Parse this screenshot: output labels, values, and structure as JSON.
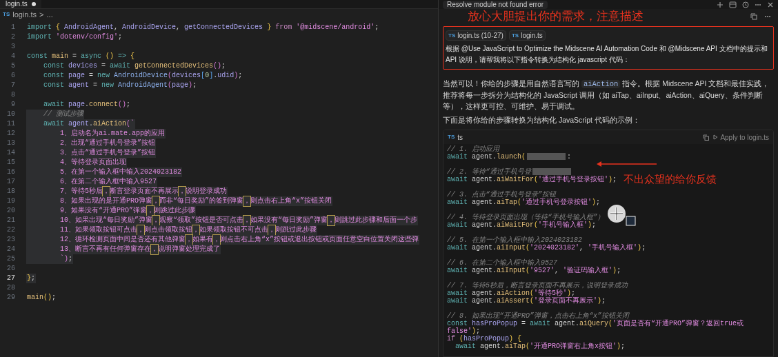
{
  "editor": {
    "tab": {
      "title": "login.ts",
      "modified": true
    },
    "breadcrumb": {
      "file_badge": "TS",
      "file": "login.ts",
      "separator": ">",
      "rest": "..."
    },
    "lines": [
      {
        "n": "1",
        "selected": false,
        "active": false,
        "tokens": [
          {
            "kind": "kw",
            "text": "import "
          },
          {
            "kind": "brace",
            "text": "{ "
          },
          {
            "kind": "id",
            "text": "AndroidAgent"
          },
          {
            "kind": "plain",
            "text": ", "
          },
          {
            "kind": "id",
            "text": "AndroidDevice"
          },
          {
            "kind": "plain",
            "text": ", "
          },
          {
            "kind": "id",
            "text": "getConnectedDevices "
          },
          {
            "kind": "brace",
            "text": "} "
          },
          {
            "kind": "kw2",
            "text": "from "
          },
          {
            "kind": "str",
            "text": "'@midscene/android'"
          },
          {
            "kind": "plain",
            "text": ";"
          }
        ]
      },
      {
        "n": "2",
        "selected": false,
        "active": false,
        "tokens": [
          {
            "kind": "kw",
            "text": "import "
          },
          {
            "kind": "str",
            "text": "'dotenv/config'"
          },
          {
            "kind": "plain",
            "text": ";"
          }
        ]
      },
      {
        "n": "3",
        "selected": false,
        "active": false
      },
      {
        "n": "4",
        "selected": false,
        "active": false,
        "tokens": [
          {
            "kind": "kw",
            "text": "const "
          },
          {
            "kind": "fn",
            "text": "main "
          },
          {
            "kind": "plain",
            "text": "= "
          },
          {
            "kind": "kw",
            "text": "async "
          },
          {
            "kind": "brace",
            "text": "() "
          },
          {
            "kind": "kw",
            "text": "=> "
          },
          {
            "kind": "brace",
            "text": "{"
          }
        ]
      },
      {
        "n": "5",
        "selected": false,
        "active": false,
        "tokens": [
          {
            "kind": "kw",
            "text": "    const "
          },
          {
            "kind": "id",
            "text": "devices "
          },
          {
            "kind": "plain",
            "text": "= "
          },
          {
            "kind": "kw",
            "text": "await "
          },
          {
            "kind": "fn",
            "text": "getConnectedDevices"
          },
          {
            "kind": "brace2",
            "text": "()"
          },
          {
            "kind": "plain",
            "text": ";"
          }
        ]
      },
      {
        "n": "6",
        "selected": false,
        "active": false,
        "tokens": [
          {
            "kind": "kw",
            "text": "    const "
          },
          {
            "kind": "id",
            "text": "page "
          },
          {
            "kind": "plain",
            "text": "= "
          },
          {
            "kind": "kw",
            "text": "new "
          },
          {
            "kind": "cls",
            "text": "AndroidDevice"
          },
          {
            "kind": "brace2",
            "text": "("
          },
          {
            "kind": "id",
            "text": "devices"
          },
          {
            "kind": "brace3",
            "text": "["
          },
          {
            "kind": "num",
            "text": "0"
          },
          {
            "kind": "brace3",
            "text": "]"
          },
          {
            "kind": "plain",
            "text": "."
          },
          {
            "kind": "id",
            "text": "udid"
          },
          {
            "kind": "brace2",
            "text": ")"
          },
          {
            "kind": "plain",
            "text": ";"
          }
        ]
      },
      {
        "n": "7",
        "selected": false,
        "active": false,
        "tokens": [
          {
            "kind": "kw",
            "text": "    const "
          },
          {
            "kind": "id",
            "text": "agent "
          },
          {
            "kind": "plain",
            "text": "= "
          },
          {
            "kind": "kw",
            "text": "new "
          },
          {
            "kind": "cls",
            "text": "AndroidAgent"
          },
          {
            "kind": "brace2",
            "text": "("
          },
          {
            "kind": "id",
            "text": "page"
          },
          {
            "kind": "brace2",
            "text": ")"
          },
          {
            "kind": "plain",
            "text": ";"
          }
        ]
      },
      {
        "n": "8",
        "selected": false,
        "active": false
      },
      {
        "n": "9",
        "selected": false,
        "active": false,
        "tokens": [
          {
            "kind": "kw",
            "text": "    await "
          },
          {
            "kind": "id",
            "text": "page"
          },
          {
            "kind": "plain",
            "text": "."
          },
          {
            "kind": "fn",
            "text": "connect"
          },
          {
            "kind": "brace2",
            "text": "()"
          },
          {
            "kind": "plain",
            "text": ";"
          }
        ]
      },
      {
        "n": "10",
        "selected": true,
        "active": false,
        "tokens": [
          {
            "kind": "cmt",
            "text": "    // 测试步骤"
          }
        ]
      },
      {
        "n": "11",
        "selected": true,
        "active": false,
        "tokens": [
          {
            "kind": "kw",
            "text": "    await "
          },
          {
            "kind": "id",
            "text": "agent"
          },
          {
            "kind": "plain",
            "text": "."
          },
          {
            "kind": "fn",
            "text": "aiAction"
          },
          {
            "kind": "brace2",
            "text": "("
          },
          {
            "kind": "str",
            "text": "`"
          }
        ]
      },
      {
        "n": "12",
        "selected": true,
        "active": false,
        "tokens": [
          {
            "kind": "str",
            "text": "        1、启动名为ai.mate.app的应用"
          }
        ]
      },
      {
        "n": "13",
        "selected": true,
        "active": false,
        "tokens": [
          {
            "kind": "str",
            "text": "        2、出现“通过手机号登录”按钮"
          }
        ]
      },
      {
        "n": "14",
        "selected": true,
        "active": false,
        "tokens": [
          {
            "kind": "str",
            "text": "        3、点击“通过手机号登录”按钮"
          }
        ]
      },
      {
        "n": "15",
        "selected": true,
        "active": false,
        "tokens": [
          {
            "kind": "str",
            "text": "        4、等待登录页面出现"
          }
        ]
      },
      {
        "n": "16",
        "selected": true,
        "active": false,
        "tokens": [
          {
            "kind": "str",
            "text": "        5、在第一个输入框中输入2024023182"
          }
        ]
      },
      {
        "n": "17",
        "selected": true,
        "active": false,
        "tokens": [
          {
            "kind": "str",
            "text": "        6、在第二个输入框中输入9527"
          }
        ]
      },
      {
        "n": "18",
        "selected": true,
        "active": false,
        "tokens": [
          {
            "kind": "str",
            "text": "        7、等待5秒后"
          },
          {
            "kind": "amb",
            "text": "，"
          },
          {
            "kind": "str",
            "text": "断言登录页面不再展示"
          },
          {
            "kind": "amb",
            "text": "，"
          },
          {
            "kind": "str",
            "text": "说明登录成功"
          }
        ]
      },
      {
        "n": "19",
        "selected": true,
        "active": false,
        "tokens": [
          {
            "kind": "str",
            "text": "        8、如果出现的是开通PRO弹窗"
          },
          {
            "kind": "amb",
            "text": "，"
          },
          {
            "kind": "str",
            "text": "而非“每日奖励”的签到弹窗"
          },
          {
            "kind": "amb",
            "text": "，"
          },
          {
            "kind": "str",
            "text": "则点击右上角“x”按钮关闭"
          }
        ]
      },
      {
        "n": "20",
        "selected": true,
        "active": false,
        "tokens": [
          {
            "kind": "str",
            "text": "        9、如果没有“开通PRO”弹窗"
          },
          {
            "kind": "amb",
            "text": "，"
          },
          {
            "kind": "str",
            "text": "则跳过此步骤"
          }
        ]
      },
      {
        "n": "21",
        "selected": true,
        "active": false,
        "tokens": [
          {
            "kind": "str",
            "text": "        10、如果出现“每日奖励”弹窗"
          },
          {
            "kind": "amb",
            "text": "，"
          },
          {
            "kind": "str",
            "text": "观察“领取”按钮是否可点击"
          },
          {
            "kind": "amb",
            "text": "，"
          },
          {
            "kind": "str",
            "text": "如果没有“每日奖励”弹窗"
          },
          {
            "kind": "amb",
            "text": "，"
          },
          {
            "kind": "str",
            "text": "则跳过此步骤和后面一个步"
          }
        ]
      },
      {
        "n": "22",
        "selected": true,
        "active": false,
        "tokens": [
          {
            "kind": "str",
            "text": "        11、如果领取按钮可点击"
          },
          {
            "kind": "amb",
            "text": "，"
          },
          {
            "kind": "str",
            "text": "则点击领取按钮"
          },
          {
            "kind": "amb",
            "text": "，"
          },
          {
            "kind": "str",
            "text": "如果领取按钮不可点击"
          },
          {
            "kind": "amb",
            "text": "，"
          },
          {
            "kind": "str",
            "text": "则跳过此步骤"
          }
        ]
      },
      {
        "n": "23",
        "selected": true,
        "active": false,
        "tokens": [
          {
            "kind": "str",
            "text": "        12、循环检测页面中间是否还有其他弹窗"
          },
          {
            "kind": "amb",
            "text": "，"
          },
          {
            "kind": "str",
            "text": "如果有"
          },
          {
            "kind": "amb",
            "text": "，"
          },
          {
            "kind": "str",
            "text": "则点击右上角“x”按钮或退出按钮或页面任意空白位置关闭这些弹"
          }
        ]
      },
      {
        "n": "24",
        "selected": true,
        "active": false,
        "tokens": [
          {
            "kind": "str",
            "text": "        13、断言不再有任何弹窗存在"
          },
          {
            "kind": "amb",
            "text": "，"
          },
          {
            "kind": "str",
            "text": "说明弹窗处理完成了"
          }
        ]
      },
      {
        "n": "25",
        "selected": true,
        "active": false,
        "tokens": [
          {
            "kind": "str",
            "text": "        `"
          },
          {
            "kind": "brace2",
            "text": ")"
          },
          {
            "kind": "plain",
            "text": ";"
          }
        ]
      },
      {
        "n": "26",
        "selected": false,
        "active": false
      },
      {
        "n": "27",
        "selected": true,
        "active": true,
        "tokens": [
          {
            "kind": "brace",
            "text": "}"
          },
          {
            "kind": "plain",
            "text": ";"
          }
        ]
      },
      {
        "n": "28",
        "selected": false,
        "active": false
      },
      {
        "n": "29",
        "selected": false,
        "active": false,
        "tokens": [
          {
            "kind": "fn",
            "text": "main"
          },
          {
            "kind": "brace",
            "text": "()"
          },
          {
            "kind": "plain",
            "text": ";"
          }
        ]
      }
    ]
  },
  "chat": {
    "tab": "Resolve module not found error",
    "annotation_top": "放心大胆提出你的需求，注意描述",
    "user_message": {
      "chips": [
        {
          "badge": "TS",
          "label": "login.ts (10-27)"
        },
        {
          "badge": "TS",
          "label": "login.ts"
        }
      ],
      "text": "根据 @Use JavaScript to Optimize the Midscene AI Automation Code 和 @Midscene API 文档中的提示和 API 说明，请帮我将以下指令转换为结构化 javascript 代码："
    },
    "paragraphs": [
      [
        {
          "kind": "text",
          "text": "当然可以！你给的步骤是用自然语言写的 "
        },
        {
          "kind": "code",
          "text": "aiAction"
        },
        {
          "kind": "text",
          "text": " 指令。根据 Midscene API 文档和最佳实践，推荐将每一步拆分为结构化的 JavaScript 调用（如 aiTap、aiInput、aiAction、aiQuery、条件判断等），这样更可控、可维护、易于调试。"
        }
      ],
      [
        {
          "kind": "text",
          "text": "下面是将你给的步骤转换为结构化 JavaScript 代码的示例："
        }
      ]
    ],
    "code_block": {
      "badge": "TS",
      "language": "ts",
      "apply": "Apply to login.ts",
      "lines": [
        {
          "kind": "code",
          "parts": [
            {
              "kind": "cmt",
              "text": "// 1. 启动应用"
            }
          ]
        },
        {
          "kind": "code",
          "parts": [
            {
              "kind": "kw",
              "text": "await "
            },
            {
              "kind": "plain",
              "text": "agent."
            },
            {
              "kind": "fn",
              "text": "launch"
            },
            {
              "kind": "brace",
              "text": "("
            },
            {
              "kind": "blur"
            },
            {
              "kind": "plain",
              "text": ":"
            }
          ]
        },
        {
          "kind": "blank"
        },
        {
          "kind": "code",
          "parts": [
            {
              "kind": "cmt",
              "text": "// 2. 等待“通过手机号登"
            },
            {
              "kind": "blur"
            }
          ]
        },
        {
          "kind": "code",
          "parts": [
            {
              "kind": "kw",
              "text": "await "
            },
            {
              "kind": "plain",
              "text": "agent."
            },
            {
              "kind": "fn",
              "text": "aiWaitFor"
            },
            {
              "kind": "brace",
              "text": "("
            },
            {
              "kind": "str",
              "text": "'通过手机号登录按钮'"
            },
            {
              "kind": "brace",
              "text": ")"
            },
            {
              "kind": "plain",
              "text": ";"
            }
          ]
        },
        {
          "kind": "blank"
        },
        {
          "kind": "code",
          "parts": [
            {
              "kind": "cmt",
              "text": "// 3. 点击“通过手机号登录”按钮"
            }
          ]
        },
        {
          "kind": "code",
          "parts": [
            {
              "kind": "kw",
              "text": "await "
            },
            {
              "kind": "plain",
              "text": "agent."
            },
            {
              "kind": "fn",
              "text": "aiTap"
            },
            {
              "kind": "brace",
              "text": "("
            },
            {
              "kind": "str",
              "text": "'通过手机号登录按钮'"
            },
            {
              "kind": "brace",
              "text": ")"
            },
            {
              "kind": "plain",
              "text": ";"
            }
          ]
        },
        {
          "kind": "blank"
        },
        {
          "kind": "code",
          "parts": [
            {
              "kind": "cmt",
              "text": "// 4. 等待登录页面出现（等待“手机号输入框”）"
            }
          ]
        },
        {
          "kind": "code",
          "parts": [
            {
              "kind": "kw",
              "text": "await "
            },
            {
              "kind": "plain",
              "text": "agent."
            },
            {
              "kind": "fn",
              "text": "aiWaitFor"
            },
            {
              "kind": "brace",
              "text": "("
            },
            {
              "kind": "str",
              "text": "'手机号输入框'"
            },
            {
              "kind": "brace",
              "text": ")"
            },
            {
              "kind": "plain",
              "text": ";"
            }
          ]
        },
        {
          "kind": "blank"
        },
        {
          "kind": "code",
          "parts": [
            {
              "kind": "cmt",
              "text": "// 5. 在第一个输入框中输入2024023182"
            }
          ]
        },
        {
          "kind": "code",
          "parts": [
            {
              "kind": "kw",
              "text": "await "
            },
            {
              "kind": "plain",
              "text": "agent."
            },
            {
              "kind": "fn",
              "text": "aiInput"
            },
            {
              "kind": "brace",
              "text": "("
            },
            {
              "kind": "str",
              "text": "'2024023182'"
            },
            {
              "kind": "plain",
              "text": ", "
            },
            {
              "kind": "str",
              "text": "'手机号输入框'"
            },
            {
              "kind": "brace",
              "text": ")"
            },
            {
              "kind": "plain",
              "text": ";"
            }
          ]
        },
        {
          "kind": "blank"
        },
        {
          "kind": "code",
          "parts": [
            {
              "kind": "cmt",
              "text": "// 6. 在第二个输入框中输入9527"
            }
          ]
        },
        {
          "kind": "code",
          "parts": [
            {
              "kind": "kw",
              "text": "await "
            },
            {
              "kind": "plain",
              "text": "agent."
            },
            {
              "kind": "fn",
              "text": "aiInput"
            },
            {
              "kind": "brace",
              "text": "("
            },
            {
              "kind": "str",
              "text": "'9527'"
            },
            {
              "kind": "plain",
              "text": ", "
            },
            {
              "kind": "str",
              "text": "'验证码输入框'"
            },
            {
              "kind": "brace",
              "text": ")"
            },
            {
              "kind": "plain",
              "text": ";"
            }
          ]
        },
        {
          "kind": "blank"
        },
        {
          "kind": "code",
          "parts": [
            {
              "kind": "cmt",
              "text": "// 7. 等待5秒后，断言登录页面不再展示，说明登录成功"
            }
          ]
        },
        {
          "kind": "code",
          "parts": [
            {
              "kind": "kw",
              "text": "await "
            },
            {
              "kind": "plain",
              "text": "agent."
            },
            {
              "kind": "fn",
              "text": "aiAction"
            },
            {
              "kind": "brace",
              "text": "("
            },
            {
              "kind": "str",
              "text": "'等待5秒'"
            },
            {
              "kind": "brace",
              "text": ")"
            },
            {
              "kind": "plain",
              "text": ";"
            }
          ]
        },
        {
          "kind": "code",
          "parts": [
            {
              "kind": "kw",
              "text": "await "
            },
            {
              "kind": "plain",
              "text": "agent."
            },
            {
              "kind": "fn",
              "text": "aiAssert"
            },
            {
              "kind": "brace",
              "text": "("
            },
            {
              "kind": "str",
              "text": "'登录页面不再展示'"
            },
            {
              "kind": "brace",
              "text": ")"
            },
            {
              "kind": "plain",
              "text": ";"
            }
          ]
        },
        {
          "kind": "blank"
        },
        {
          "kind": "code",
          "parts": [
            {
              "kind": "cmt",
              "text": "// 8. 如果出现“开通PRO”弹窗，点击右上角“x”按钮关闭"
            }
          ]
        },
        {
          "kind": "code",
          "parts": [
            {
              "kind": "kw",
              "text": "const "
            },
            {
              "kind": "id",
              "text": "hasProPopup "
            },
            {
              "kind": "plain",
              "text": "= "
            },
            {
              "kind": "kw",
              "text": "await "
            },
            {
              "kind": "plain",
              "text": "agent."
            },
            {
              "kind": "fn",
              "text": "aiQuery"
            },
            {
              "kind": "brace",
              "text": "("
            },
            {
              "kind": "str",
              "text": "'页面是否有“开通PRO”弹窗？返回true或false'"
            },
            {
              "kind": "brace",
              "text": ")"
            },
            {
              "kind": "plain",
              "text": ";"
            }
          ]
        },
        {
          "kind": "code",
          "parts": [
            {
              "kind": "kw2",
              "text": "if "
            },
            {
              "kind": "brace",
              "text": "("
            },
            {
              "kind": "id",
              "text": "hasProPopup"
            },
            {
              "kind": "brace",
              "text": ") {"
            }
          ]
        },
        {
          "kind": "code",
          "parts": [
            {
              "kind": "kw",
              "text": "  await "
            },
            {
              "kind": "plain",
              "text": "agent."
            },
            {
              "kind": "fn",
              "text": "aiTap"
            },
            {
              "kind": "brace",
              "text": "("
            },
            {
              "kind": "str",
              "text": "'开通PRO弹窗右上角x按钮'"
            },
            {
              "kind": "brace",
              "text": ")"
            },
            {
              "kind": "plain",
              "text": ";"
            }
          ]
        }
      ]
    },
    "annotation_side": "不出众望的给你反馈"
  }
}
